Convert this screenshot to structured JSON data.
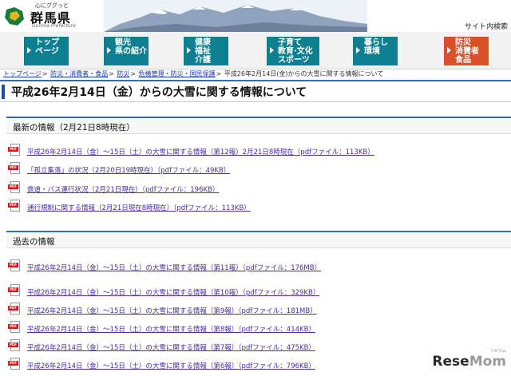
{
  "header": {
    "tagline": "心にググっと",
    "site_name": "群馬県",
    "site_name_en": "Gunma Prefecture",
    "site_search": "サイト内検索"
  },
  "nav": [
    {
      "label": "トップ\nページ",
      "color": "#0e7f90"
    },
    {
      "label": "観光\n県の紹介",
      "color": "#0e7f90"
    },
    {
      "label": "健康\n福祉\n介護",
      "color": "#0e7f90"
    },
    {
      "label": "子育て\n教育·文化\nスポーツ",
      "color": "#0e7f90"
    },
    {
      "label": "暮らし\n環境",
      "color": "#0e7f90"
    },
    {
      "label": "防災\n消費者\n食品",
      "color": "#d9512a"
    }
  ],
  "breadcrumb": [
    "トップページ",
    "防災・消費者・食品",
    "防災",
    "危機管理・防災・国民保護",
    "平成26年2月14日(金)からの大雪に関する情報について"
  ],
  "page_title": "平成26年2月14日（金）からの大雪に関する情報について",
  "latest": {
    "heading": "最新の情報（2月21日8時現在）",
    "items": [
      "平成26年2月14日（金）～15日（土）の大雪に関する情報（第12報）2月21日8時現在（pdfファイル：113KB）",
      "「孤立集落」の状況（2月20日19時現在）（pdfファイル：49KB）",
      "鉄道・バス運行状況（2月21日現在）（pdfファイル：196KB）",
      "通行規制に関する情報（2月21日現在8時現在）（pdfファイル：113KB）"
    ]
  },
  "past": {
    "heading": "過去の情報",
    "items": [
      "平成26年2月14日（金）～15日（土）の大雪に関する情報（第11報）（pdfファイル：176MB）",
      "平成26年2月14日（金）～15日（土）の大雪に関する情報（第10報）（pdfファイル：329KB）",
      "平成26年2月14日（金）～15日（土）の大雪に関する情報（第9報）（pdfファイル：181MB）",
      "平成26年2月14日（金）～15日（土）の大雪に関する情報（第8報）（pdfファイル：414KB）",
      "平成26年2月14日（金）～15日（土）の大雪に関する情報（第7報）（pdfファイル：475KB）",
      "平成26年2月14日（金）～15日（土）の大雪に関する情報（第6報）（pdfファイル：796KB）"
    ]
  },
  "pdf_icon_label": "PDF",
  "watermark": {
    "text_a": "Rese",
    "text_b": "Mom",
    "kana": "リセマム"
  },
  "colors": {
    "accent": "#2f6fb3",
    "nav_teal": "#0e7f90",
    "nav_orange": "#d9512a",
    "link": "#4a2aa6"
  }
}
